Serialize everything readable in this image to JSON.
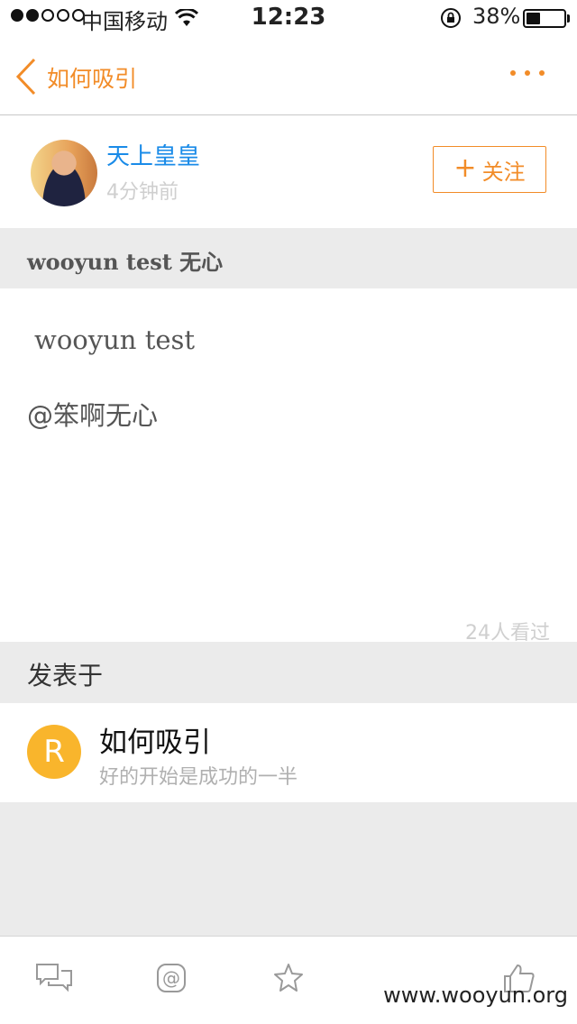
{
  "status_bar": {
    "carrier": "中国移动",
    "time": "12:23",
    "battery_pct": "38%",
    "battery_level": 0.38,
    "signal_bars": 2
  },
  "nav": {
    "title": "如何吸引",
    "accent_color": "#f28c28"
  },
  "author": {
    "name": "天上皇皇",
    "time": "4分钟前",
    "follow_label": "关注"
  },
  "post": {
    "title": "wooyun test 无心",
    "body_line1": "wooyun test",
    "body_line2": "@笨啊无心",
    "views": "24人看过"
  },
  "posted_in": {
    "header": "发表于",
    "group_initial": "R",
    "group_name": "如何吸引",
    "group_desc": "好的开始是成功的一半"
  },
  "toolbar": {
    "icons": [
      "comment-icon",
      "at-icon",
      "star-icon",
      "like-icon"
    ]
  },
  "watermark": "www.wooyun.org"
}
